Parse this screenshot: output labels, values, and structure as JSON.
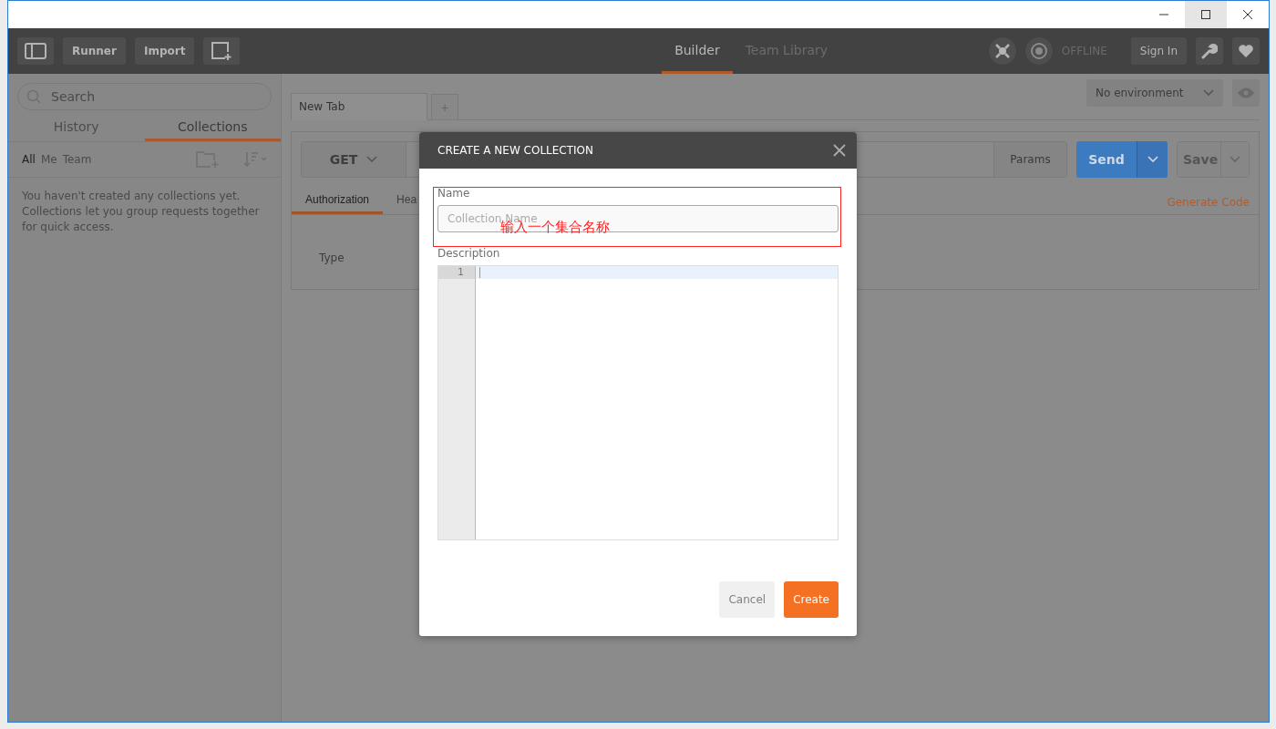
{
  "header": {
    "runner": "Runner",
    "import": "Import",
    "tabs": [
      {
        "label": "Builder",
        "selected": true
      },
      {
        "label": "Team Library",
        "selected": false
      }
    ],
    "status": "OFFLINE",
    "sign_in": "Sign In"
  },
  "sidebar": {
    "search": {
      "placeholder": "Search"
    },
    "tabs": [
      {
        "label": "History",
        "selected": false
      },
      {
        "label": "Collections",
        "selected": true
      }
    ],
    "filters": [
      {
        "label": "All",
        "selected": true
      },
      {
        "label": "Me",
        "selected": false
      },
      {
        "label": "Team",
        "selected": false
      }
    ],
    "empty_message": "You haven't created any collections yet. Collections let you group requests together for quick access."
  },
  "request_tabs": [
    {
      "label": "New Tab",
      "selected": true
    }
  ],
  "add_tab": "+",
  "environment": "No environment",
  "request": {
    "method": "GET",
    "params": "Params",
    "send": "Send",
    "save": "Save",
    "tabs": [
      {
        "label": "Authorization",
        "selected": true
      },
      {
        "label": "Hea",
        "selected": false
      }
    ],
    "generate_code": "Generate Code",
    "type_label": "Type"
  },
  "dialog": {
    "title": "CREATE A NEW COLLECTION",
    "name_label": "Name",
    "name_placeholder": "Collection Name",
    "description_label": "Description",
    "line_numbers": [
      "1"
    ],
    "buttons": [
      {
        "label": "Cancel",
        "kind": "secondary"
      },
      {
        "label": "Create",
        "kind": "primary"
      }
    ]
  },
  "annotation": "输入一个集合名称"
}
